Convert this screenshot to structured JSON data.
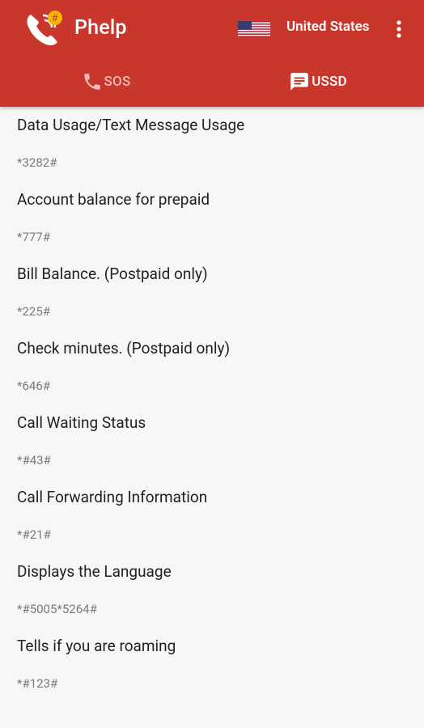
{
  "app": {
    "title": "Phelp",
    "country": "United States",
    "colors": {
      "primary": "#c9372c",
      "accent": "#f4b400",
      "inactive_tab": "#f3b9b4"
    }
  },
  "tabs": [
    {
      "label": "SOS",
      "icon": "phone-icon",
      "active": false
    },
    {
      "label": "USSD",
      "icon": "message-icon",
      "active": true
    }
  ],
  "codes": [
    {
      "title": "Data Usage/Text Message Usage",
      "code": "*3282#"
    },
    {
      "title": "Account balance for prepaid",
      "code": "*777#"
    },
    {
      "title": "Bill Balance. (Postpaid only)",
      "code": "*225#"
    },
    {
      "title": "Check minutes. (Postpaid only)",
      "code": "*646#"
    },
    {
      "title": "Call Waiting Status",
      "code": "*#43#"
    },
    {
      "title": "Call Forwarding Information",
      "code": "*#21#"
    },
    {
      "title": "Displays the Language",
      "code": "*#5005*5264#"
    },
    {
      "title": "Tells if you are roaming",
      "code": "*#123#"
    }
  ]
}
